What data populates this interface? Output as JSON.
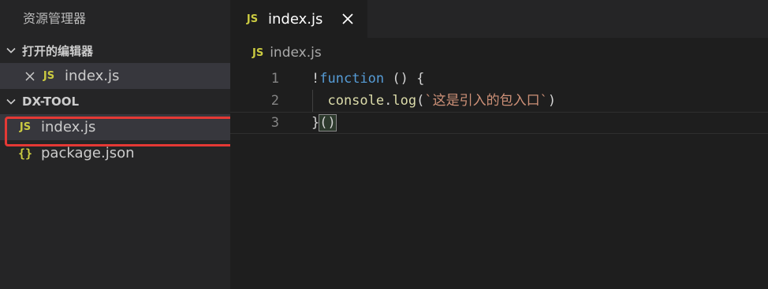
{
  "sidebar": {
    "title": "资源管理器",
    "open_editors": {
      "header": "打开的编辑器",
      "items": [
        {
          "icon": "JS",
          "label": "index.js"
        }
      ]
    },
    "project": {
      "header": "DX-TOOL",
      "items": [
        {
          "icon": "JS",
          "label": "index.js"
        },
        {
          "icon": "{}",
          "label": "package.json"
        }
      ]
    }
  },
  "editor": {
    "tab": {
      "icon": "JS",
      "label": "index.js"
    },
    "breadcrumb": {
      "icon": "JS",
      "label": "index.js"
    },
    "lines": [
      {
        "number": "1",
        "tokens": [
          {
            "text": "!",
            "cls": "plain"
          },
          {
            "text": "function",
            "cls": "kw"
          },
          {
            "text": " () {",
            "cls": "plain"
          }
        ]
      },
      {
        "number": "2",
        "tokens": [
          {
            "text": "  console",
            "cls": "fn"
          },
          {
            "text": ".",
            "cls": "plain"
          },
          {
            "text": "log",
            "cls": "fn"
          },
          {
            "text": "(",
            "cls": "plain"
          },
          {
            "text": "`这是引入的包入口`",
            "cls": "str"
          },
          {
            "text": ")",
            "cls": "plain"
          }
        ]
      },
      {
        "number": "3",
        "tokens": [
          {
            "text": "}",
            "cls": "plain"
          },
          {
            "text": "()",
            "cls": "plain bracket-match"
          }
        ]
      }
    ]
  },
  "colors": {
    "sidebar_bg": "#252526",
    "editor_bg": "#1e1e1e",
    "js_icon": "#cbcb41",
    "highlight_box": "#e53935"
  }
}
